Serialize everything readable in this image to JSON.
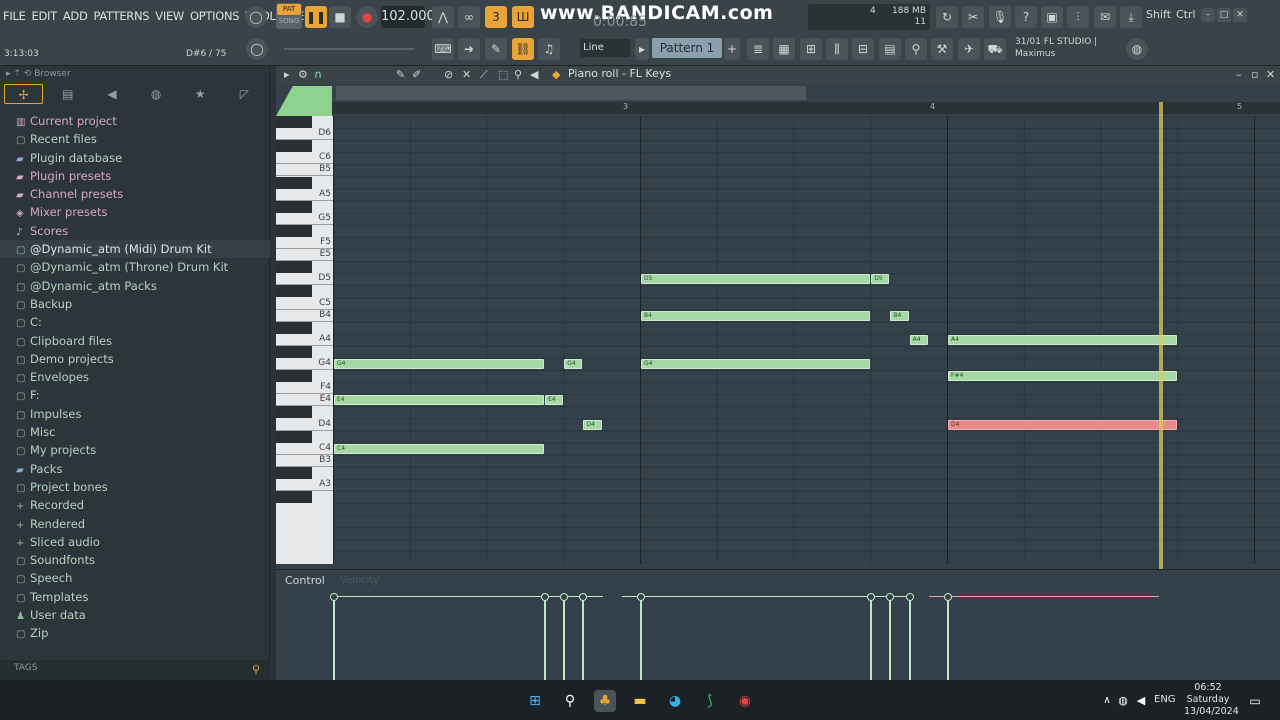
{
  "menu": [
    "FILE",
    "EDIT",
    "ADD",
    "PATTERNS",
    "VIEW",
    "OPTIONS",
    "TOOLS",
    "HELP"
  ],
  "transport": {
    "pat_label": "PAT",
    "song_label": "SONG",
    "tempo": "102.000",
    "timecode": "0:00:85"
  },
  "watermark": "www.BANDICAM.com",
  "memory": {
    "cpu_count": "4",
    "ram": "188 MB",
    "polyphony": "11"
  },
  "keys": {
    "shift": "Shift",
    "ctrl": "Ctrl"
  },
  "hint": {
    "line1": "31/01  FL STUDIO |",
    "line2": "Maximus"
  },
  "snap": "Line",
  "pattern": "Pattern 1",
  "status": {
    "time": "3:13:03",
    "cpu": "D#6 / 75"
  },
  "browser": {
    "header": "Browser",
    "items": [
      {
        "label": "Current project",
        "icon": "▥",
        "style": "pink"
      },
      {
        "label": "Recent files",
        "icon": "▢",
        "style": ""
      },
      {
        "label": "Plugin database",
        "icon": "▰",
        "style": "blue"
      },
      {
        "label": "Plugin presets",
        "icon": "▰",
        "style": "pink"
      },
      {
        "label": "Channel presets",
        "icon": "▰",
        "style": "pink"
      },
      {
        "label": "Mixer presets",
        "icon": "◈",
        "style": "pink"
      },
      {
        "label": "Scores",
        "icon": "♪",
        "style": "pink"
      },
      {
        "label": "@Dynamic_atm (Midi) Drum Kit",
        "icon": "▢",
        "style": "hl"
      },
      {
        "label": "@Dynamic_atm (Throne) Drum Kit",
        "icon": "▢",
        "style": ""
      },
      {
        "label": "@Dynamic_atm Packs",
        "icon": "▢",
        "style": ""
      },
      {
        "label": "Backup",
        "icon": "▢",
        "style": ""
      },
      {
        "label": "C:",
        "icon": "▢",
        "style": ""
      },
      {
        "label": "Clipboard files",
        "icon": "▢",
        "style": ""
      },
      {
        "label": "Demo projects",
        "icon": "▢",
        "style": ""
      },
      {
        "label": "Envelopes",
        "icon": "▢",
        "style": ""
      },
      {
        "label": "F:",
        "icon": "▢",
        "style": ""
      },
      {
        "label": "Impulses",
        "icon": "▢",
        "style": ""
      },
      {
        "label": "Misc",
        "icon": "▢",
        "style": ""
      },
      {
        "label": "My projects",
        "icon": "▢",
        "style": ""
      },
      {
        "label": "Packs",
        "icon": "▰",
        "style": "blue"
      },
      {
        "label": "Project bones",
        "icon": "▢",
        "style": ""
      },
      {
        "label": "Recorded",
        "icon": "+",
        "style": ""
      },
      {
        "label": "Rendered",
        "icon": "+",
        "style": ""
      },
      {
        "label": "Sliced audio",
        "icon": "+",
        "style": ""
      },
      {
        "label": "Soundfonts",
        "icon": "▢",
        "style": ""
      },
      {
        "label": "Speech",
        "icon": "▢",
        "style": ""
      },
      {
        "label": "Templates",
        "icon": "▢",
        "style": ""
      },
      {
        "label": "User data",
        "icon": "♟",
        "style": ""
      },
      {
        "label": "Zip",
        "icon": "▢",
        "style": ""
      }
    ],
    "tags": "TAGS"
  },
  "pianoroll": {
    "title": "Piano roll - FL Keys",
    "bars": [
      "3",
      "4",
      "5"
    ],
    "key_labels": [
      "D6",
      "C6",
      "B5",
      "A5",
      "G5",
      "F5",
      "E5",
      "D5",
      "C5",
      "B4",
      "A4",
      "G4",
      "F4",
      "E4",
      "D4",
      "C4",
      "B3",
      "A3"
    ],
    "notes": [
      {
        "label": "D5",
        "start": 3.0,
        "len": 0.75,
        "pitch": "D5"
      },
      {
        "label": "D5",
        "start": 3.75,
        "len": 0.0625,
        "pitch": "D5"
      },
      {
        "label": "B4",
        "start": 3.0,
        "len": 0.75,
        "pitch": "B4"
      },
      {
        "label": "B4",
        "start": 3.8125,
        "len": 0.0625,
        "pitch": "B4"
      },
      {
        "label": "A4",
        "start": 3.875,
        "len": 0.0625,
        "pitch": "A4"
      },
      {
        "label": "A4",
        "start": 4.0,
        "len": 0.75,
        "pitch": "A4"
      },
      {
        "label": "G4",
        "start": 2.0,
        "len": 0.6875,
        "pitch": "G4"
      },
      {
        "label": "G4",
        "start": 2.75,
        "len": 0.0625,
        "pitch": "G4"
      },
      {
        "label": "G4",
        "start": 3.0,
        "len": 0.75,
        "pitch": "G4"
      },
      {
        "label": "F#4",
        "start": 4.0,
        "len": 0.75,
        "pitch": "F#4"
      },
      {
        "label": "E4",
        "start": 2.0,
        "len": 0.6875,
        "pitch": "E4"
      },
      {
        "label": "E4",
        "start": 2.6875,
        "len": 0.0625,
        "pitch": "E4"
      },
      {
        "label": "D4",
        "start": 2.8125,
        "len": 0.0625,
        "pitch": "D4"
      },
      {
        "label": "D4",
        "start": 4.0,
        "len": 0.75,
        "pitch": "D4",
        "selected": true
      },
      {
        "label": "C4",
        "start": 2.0,
        "len": 0.6875,
        "pitch": "C4"
      }
    ],
    "control": "Control",
    "control_sub": "Velocity"
  },
  "taskbar": {
    "lang": "ENG",
    "time": "06:52",
    "day": "Saturday",
    "date": "13/04/2024"
  }
}
